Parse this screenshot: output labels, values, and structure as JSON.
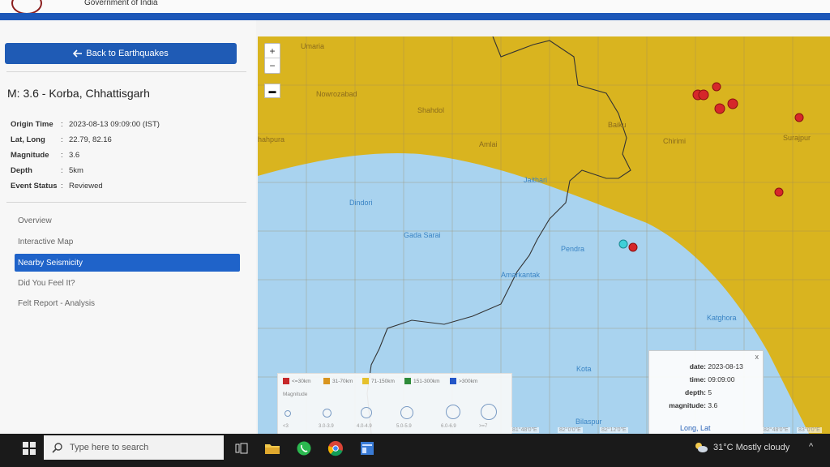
{
  "header": {
    "gov_text": "Government of India"
  },
  "left_panel": {
    "back_label": "Back to Earthquakes",
    "title": "M: 3.6 - Korba, Chhattisgarh",
    "info": [
      {
        "label": "Origin Time",
        "value": "2023-08-13 09:09:00 (IST)"
      },
      {
        "label": "Lat, Long",
        "value": "22.79, 82.16"
      },
      {
        "label": "Magnitude",
        "value": "3.6"
      },
      {
        "label": "Depth",
        "value": "5km"
      },
      {
        "label": "Event Status",
        "value": "Reviewed"
      }
    ],
    "nav": [
      {
        "label": "Overview",
        "active": false
      },
      {
        "label": "Interactive Map",
        "active": false
      },
      {
        "label": "Nearby Seismicity",
        "active": true
      },
      {
        "label": "Did You Feel It?",
        "active": false
      },
      {
        "label": "Felt Report - Analysis",
        "active": false
      }
    ]
  },
  "map": {
    "zoom_in": "+",
    "zoom_out": "−",
    "towns": [
      {
        "name": "Umaria",
        "zone": "y"
      },
      {
        "name": "Nowrozabad",
        "zone": "y"
      },
      {
        "name": "Shahdol",
        "zone": "y"
      },
      {
        "name": "Amlai",
        "zone": "y"
      },
      {
        "name": "hahpura",
        "zone": "y"
      },
      {
        "name": "Baiku",
        "zone": "y"
      },
      {
        "name": "Chirimi",
        "zone": "y"
      },
      {
        "name": "Surajpur",
        "zone": "y"
      },
      {
        "name": "Jaithari",
        "zone": "b"
      },
      {
        "name": "Dindori",
        "zone": "b"
      },
      {
        "name": "Gada Sarai",
        "zone": "b"
      },
      {
        "name": "Pendra",
        "zone": "b"
      },
      {
        "name": "Amarkantak",
        "zone": "b"
      },
      {
        "name": "Katghora",
        "zone": "b"
      },
      {
        "name": "Kota",
        "zone": "b"
      },
      {
        "name": "Bilaspur",
        "zone": "b"
      }
    ],
    "colors": {
      "inner_zone": "#a9d3ef",
      "outer_zone": "#d9b41f",
      "events": "#d6272a",
      "epicenter": "#3fd0d8"
    },
    "legend": {
      "depth_items": [
        {
          "label": "<=30km",
          "color": "#c6282b"
        },
        {
          "label": "31-70km",
          "color": "#d9951f"
        },
        {
          "label": "71-150km",
          "color": "#e6c12c"
        },
        {
          "label": "151-300km",
          "color": "#2e8b3a"
        },
        {
          "label": ">300km",
          "color": "#2456c8"
        }
      ],
      "magnitude_title": "Magnitude",
      "magnitude_items": [
        "<3",
        "3.0-3.9",
        "4.0-4.9",
        "5.0-5.9",
        "6.0-6.9",
        ">=7"
      ]
    },
    "popup": {
      "close": "x",
      "rows": [
        {
          "key": "date:",
          "value": "2023-08-13"
        },
        {
          "key": "time:",
          "value": "09:09:00"
        },
        {
          "key": "depth:",
          "value": "5"
        },
        {
          "key": "magnitude:",
          "value": "3.6"
        }
      ],
      "link": "Long, Lat"
    },
    "coords": [
      "81°48′0″E",
      "82°0′0″E",
      "82°12′0″E",
      "82°48′0″E",
      "83°0′0″E"
    ]
  },
  "taskbar": {
    "search_placeholder": "Type here to search",
    "weather": "31°C  Mostly cloudy",
    "tray_arrow": "^"
  }
}
